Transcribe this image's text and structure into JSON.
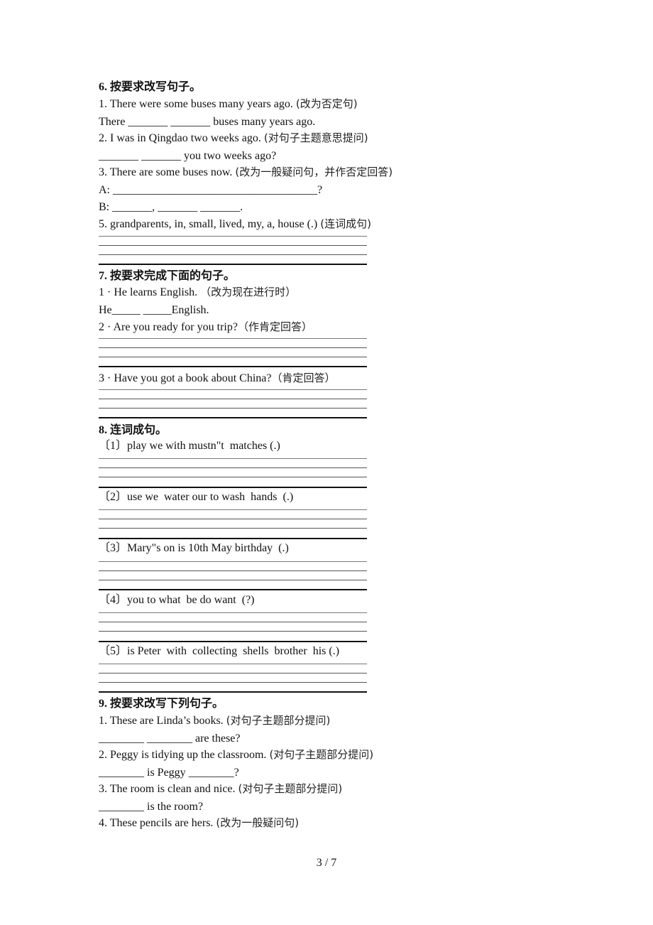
{
  "sections": [
    {
      "number": "6.",
      "title": "按要求改写句子。",
      "lines": [
        {
          "en": "1. There were some buses many years ago. ",
          "cn": "(改为否定句)"
        },
        {
          "en": "There _______ _______ buses many years ago.",
          "cn": ""
        },
        {
          "en": "2. I was in Qingdao two weeks ago. ",
          "cn": "(对句子主题意思提问)"
        },
        {
          "en": "_______ _______ you two weeks ago?",
          "cn": ""
        },
        {
          "en": "3. There are some buses now. ",
          "cn": "(改为一般疑问句，并作否定回答)"
        },
        {
          "en": "A: ____________________________________?",
          "cn": ""
        },
        {
          "en": "B: _______, _______ _______.",
          "cn": ""
        },
        {
          "en": "5. grandparents, in, small, lived, my, a, house (.) ",
          "cn": "(连词成句)"
        }
      ]
    },
    {
      "number": "7.",
      "title": "按要求完成下面的句子。",
      "lines": [
        {
          "en": "1 · He learns English. ",
          "cn": "（改为现在进行时）"
        },
        {
          "en": "He_____ _____English.",
          "cn": ""
        },
        {
          "en": "2 · Are you ready for you trip?",
          "cn": "（作肯定回答）"
        },
        {
          "en": "3 · Have you got a book about China?",
          "cn": "（肯定回答）"
        }
      ]
    },
    {
      "number": "8.",
      "title": "连词成句。",
      "lines": [
        {
          "en": "〔1〕play we with mustn\"t  matches (.)",
          "cn": ""
        },
        {
          "en": "〔2〕use we  water our to wash  hands  (.)",
          "cn": ""
        },
        {
          "en": "〔3〕Mary\"s on is 10th May birthday  (.)",
          "cn": ""
        },
        {
          "en": "〔4〕you to what  be do want  (?)",
          "cn": ""
        },
        {
          "en": "〔5〕is Peter  with  collecting  shells  brother  his (.)",
          "cn": ""
        }
      ]
    },
    {
      "number": "9.",
      "title": "按要求改写下列句子。",
      "lines": [
        {
          "en": "1. These are Linda’s books. ",
          "cn": "(对句子主题部分提问)"
        },
        {
          "en": "________ ________ are these?",
          "cn": ""
        },
        {
          "en": "2. Peggy is tidying up the classroom. ",
          "cn": "(对句子主题部分提问)"
        },
        {
          "en": "________ is Peggy ________?",
          "cn": ""
        },
        {
          "en": "3. The room is clean and nice. ",
          "cn": "(对句子主题部分提问)"
        },
        {
          "en": "________ is the room?",
          "cn": ""
        },
        {
          "en": "4. These pencils are hers. ",
          "cn": "(改为一般疑问句)"
        }
      ]
    }
  ],
  "page_number": "3 / 7"
}
